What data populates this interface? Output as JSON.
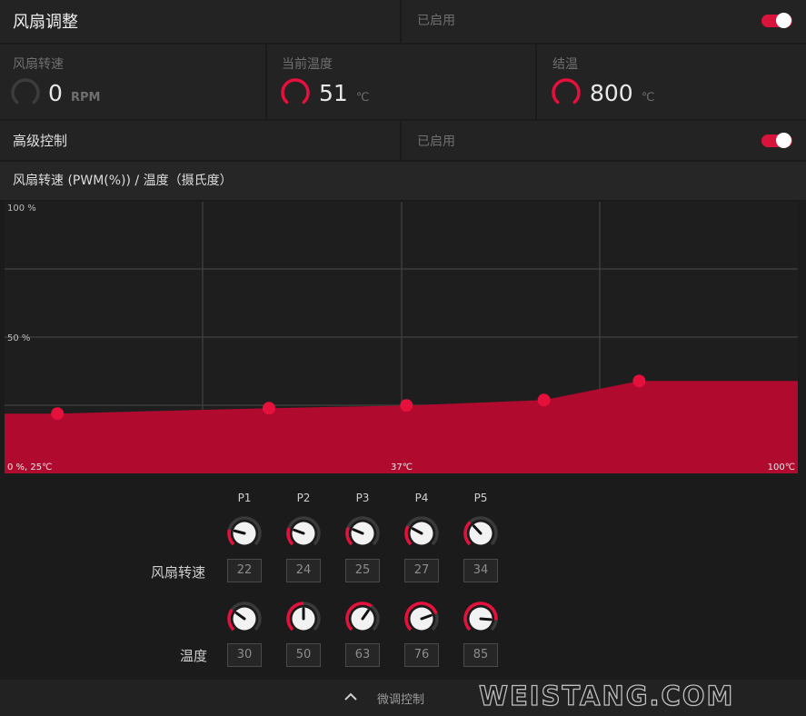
{
  "fan_tuning": {
    "title": "风扇调整",
    "status": "已启用",
    "toggle_on": true
  },
  "metrics": [
    {
      "label": "风扇转速",
      "value": "0",
      "unit": "RPM"
    },
    {
      "label": "当前温度",
      "value": "51",
      "unit": "℃"
    },
    {
      "label": "结温",
      "value": "800",
      "unit": "℃"
    }
  ],
  "advanced": {
    "label": "高级控制",
    "status": "已启用",
    "toggle_on": true
  },
  "chart_header": "风扇转速 (PWM(%)) / 温度（摄氏度）",
  "chart_data": {
    "type": "area",
    "y_tick_labels": [
      "100 %",
      "50 %"
    ],
    "x_tick_labels": [
      "0 %, 25℃",
      "37℃",
      "100℃"
    ],
    "series": [
      {
        "points": [
          {
            "x": 30,
            "y": 22
          },
          {
            "x": 50,
            "y": 24
          },
          {
            "x": 63,
            "y": 25
          },
          {
            "x": 76,
            "y": 27
          },
          {
            "x": 85,
            "y": 34
          }
        ]
      }
    ],
    "xlim": [
      25,
      100
    ],
    "ylim": [
      0,
      100
    ],
    "color": "#b00a2e",
    "point_color": "#e6103c",
    "grid": true
  },
  "points_panel": {
    "labels": [
      "P1",
      "P2",
      "P3",
      "P4",
      "P5"
    ],
    "fan_speed_label": "风扇转速",
    "fan_speed": [
      "22",
      "24",
      "25",
      "27",
      "34"
    ],
    "temperature_label": "温度",
    "temperature": [
      "30",
      "50",
      "63",
      "76",
      "85"
    ]
  },
  "footer": {
    "label": "微调控制",
    "icon": "chevron-up-icon"
  },
  "watermark": "WEISTANG.COM",
  "colors": {
    "accent": "#e6103c",
    "panel": "#232323",
    "background": "#1b1b1b"
  }
}
